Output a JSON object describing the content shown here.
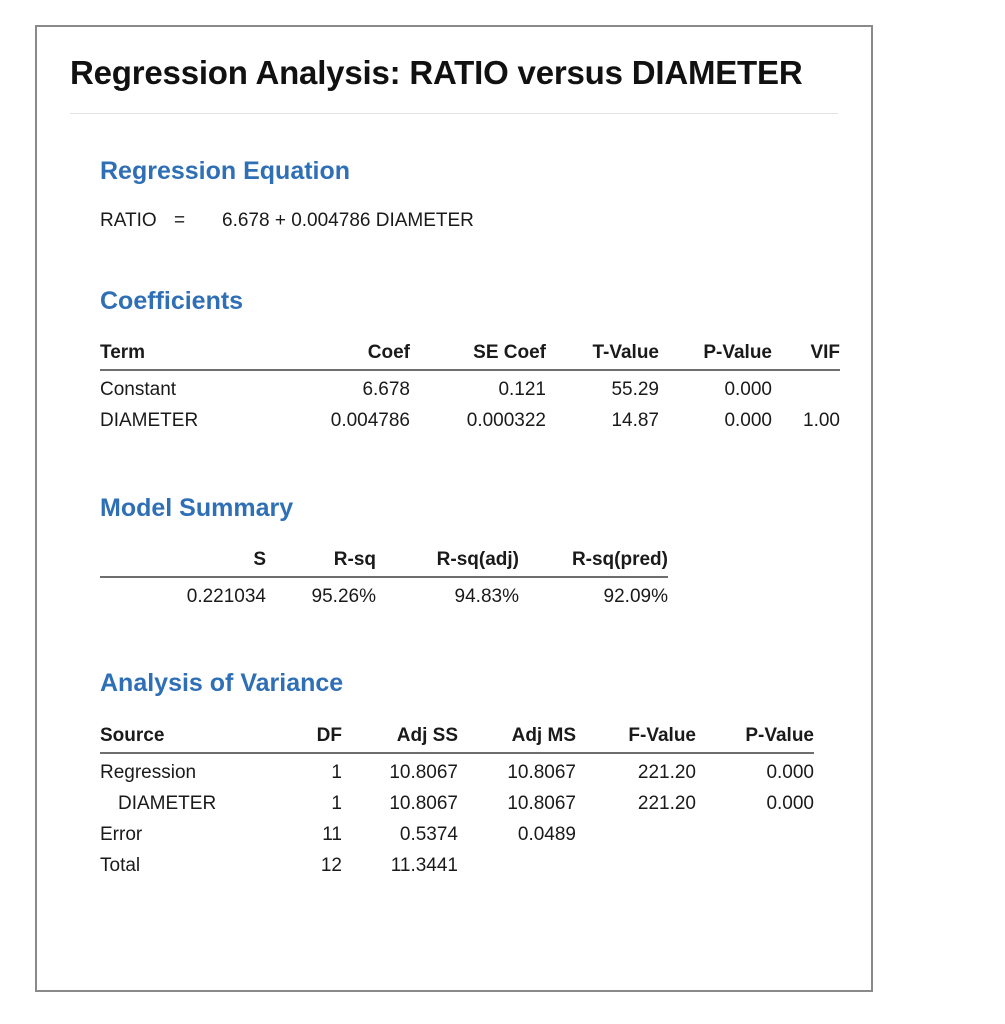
{
  "report": {
    "title": "Regression Analysis: RATIO versus DIAMETER"
  },
  "regression_equation": {
    "heading": "Regression Equation",
    "response": "RATIO",
    "equals": "=",
    "expression": "6.678 + 0.004786 DIAMETER"
  },
  "coefficients": {
    "heading": "Coefficients",
    "columns": [
      "Term",
      "Coef",
      "SE Coef",
      "T-Value",
      "P-Value",
      "VIF"
    ],
    "rows": [
      {
        "term": "Constant",
        "coef": "6.678",
        "se_coef": "0.121",
        "t_value": "55.29",
        "p_value": "0.000",
        "vif": ""
      },
      {
        "term": "DIAMETER",
        "coef": "0.004786",
        "se_coef": "0.000322",
        "t_value": "14.87",
        "p_value": "0.000",
        "vif": "1.00"
      }
    ]
  },
  "model_summary": {
    "heading": "Model Summary",
    "columns": [
      "S",
      "R-sq",
      "R-sq(adj)",
      "R-sq(pred)"
    ],
    "rows": [
      {
        "s": "0.221034",
        "r_sq": "95.26%",
        "r_sq_adj": "94.83%",
        "r_sq_pred": "92.09%"
      }
    ]
  },
  "analysis_of_variance": {
    "heading": "Analysis of Variance",
    "columns": [
      "Source",
      "DF",
      "Adj SS",
      "Adj MS",
      "F-Value",
      "P-Value"
    ],
    "rows": [
      {
        "source": "Regression",
        "df": "1",
        "adj_ss": "10.8067",
        "adj_ms": "10.8067",
        "f_value": "221.20",
        "p_value": "0.000"
      },
      {
        "source": "DIAMETER",
        "df": "1",
        "adj_ss": "10.8067",
        "adj_ms": "10.8067",
        "f_value": "221.20",
        "p_value": "0.000"
      },
      {
        "source": "Error",
        "df": "11",
        "adj_ss": "0.5374",
        "adj_ms": "0.0489",
        "f_value": "",
        "p_value": ""
      },
      {
        "source": "Total",
        "df": "12",
        "adj_ss": "11.3441",
        "adj_ms": "",
        "f_value": "",
        "p_value": ""
      }
    ]
  },
  "colors": {
    "heading_blue": "#2f6fb5",
    "body_text": "#1a1a1a",
    "card_border": "#8a8a8a",
    "rule": "#6e6e6e",
    "title_divider": "#e3e3e3"
  }
}
